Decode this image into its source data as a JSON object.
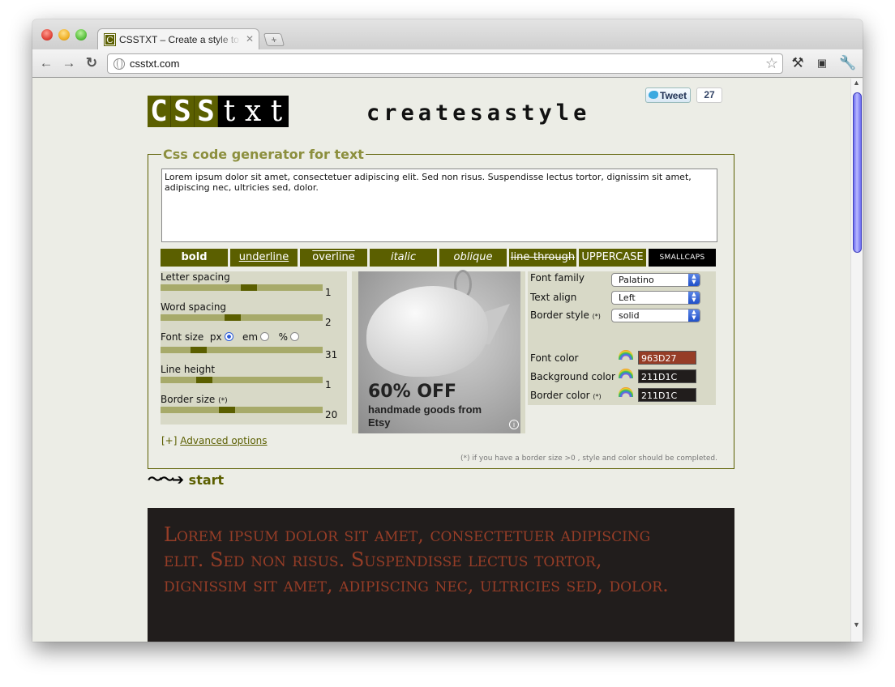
{
  "browser": {
    "tab_title": "CSSTXT – Create a style to your text",
    "tab_favicon": "C",
    "url": "csstxt.com"
  },
  "logo": {
    "letters": [
      "C",
      "S",
      "S",
      "t",
      "x",
      "t"
    ],
    "tagline": "createsastyle"
  },
  "tweet": {
    "label": "Tweet",
    "count": "27"
  },
  "generator": {
    "legend": "Css code generator for text",
    "sample_text": "Lorem ipsum dolor sit amet, consectetuer adipiscing elit. Sed non risus. Suspendisse lectus tortor, dignissim sit amet, adipiscing nec, ultricies sed, dolor.",
    "style_buttons": [
      "bold",
      "underline",
      "overline",
      "italic",
      "oblique",
      "line-through",
      "UPPERCASE",
      "SMALLCAPS"
    ],
    "sliders": {
      "letter_spacing": {
        "label": "Letter spacing",
        "value": "1"
      },
      "word_spacing": {
        "label": "Word spacing",
        "value": "2"
      },
      "font_size": {
        "label": "Font size",
        "value": "31",
        "units": [
          "px",
          "em",
          "%"
        ],
        "selected_unit": "px"
      },
      "line_height": {
        "label": "Line height",
        "value": "1"
      },
      "border_size": {
        "label": "Border size",
        "note": "(*)",
        "value": "20"
      }
    },
    "options": {
      "font_family": {
        "label": "Font family",
        "value": "Palatino"
      },
      "text_align": {
        "label": "Text align",
        "value": "Left"
      },
      "border_style": {
        "label": "Border style",
        "note": "(*)",
        "value": "solid"
      },
      "font_color": {
        "label": "Font color",
        "value": "963D27"
      },
      "background_color": {
        "label": "Background color",
        "value": "211D1C"
      },
      "border_color": {
        "label": "Border color",
        "note": "(*)",
        "value": "211D1C"
      }
    },
    "advanced_prefix": "[+]",
    "advanced_label": "Advanced options",
    "footnote": "(*) if you have a border size >0 , style and color should be completed."
  },
  "ad": {
    "headline": "60% OFF",
    "subline": "handmade goods from Etsy"
  },
  "start_label": "start",
  "preview_text": "Lorem ipsum dolor sit amet, consectetuer adipiscing elit. Sed non risus. Suspendisse lectus tortor, dignissim sit amet, adipiscing nec, ultricies sed, dolor.",
  "colors": {
    "accent": "#5b5f00",
    "font_color": "#963d27",
    "background": "#211d1c",
    "page_bg": "#ecede6"
  }
}
